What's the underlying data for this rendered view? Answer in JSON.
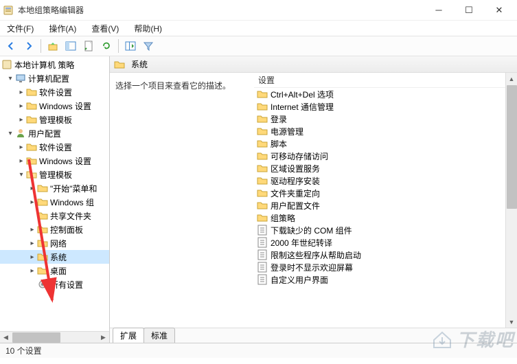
{
  "window": {
    "title": "本地组策略编辑器"
  },
  "menubar": [
    "文件(F)",
    "操作(A)",
    "查看(V)",
    "帮助(H)"
  ],
  "tree": {
    "root": "本地计算机 策略",
    "computer_config": "计算机配置",
    "cc_children": [
      "软件设置",
      "Windows 设置",
      "管理模板"
    ],
    "user_config": "用户配置",
    "uc_software": "软件设置",
    "uc_windows": "Windows 设置",
    "uc_admin": "管理模板",
    "admin_children": [
      "\"开始\"菜单和",
      "Windows 组",
      "共享文件夹",
      "控制面板",
      "网络",
      "系统",
      "桌面",
      "所有设置"
    ],
    "selected": "系统"
  },
  "right": {
    "header": "系统",
    "description": "选择一个项目来查看它的描述。",
    "column": "设置",
    "items": [
      {
        "icon": "folder",
        "label": "Ctrl+Alt+Del 选项"
      },
      {
        "icon": "folder",
        "label": "Internet 通信管理"
      },
      {
        "icon": "folder",
        "label": "登录"
      },
      {
        "icon": "folder",
        "label": "电源管理"
      },
      {
        "icon": "folder",
        "label": "脚本"
      },
      {
        "icon": "folder",
        "label": "可移动存储访问"
      },
      {
        "icon": "folder",
        "label": "区域设置服务"
      },
      {
        "icon": "folder",
        "label": "驱动程序安装"
      },
      {
        "icon": "folder",
        "label": "文件夹重定向"
      },
      {
        "icon": "folder",
        "label": "用户配置文件"
      },
      {
        "icon": "folder",
        "label": "组策略"
      },
      {
        "icon": "setting",
        "label": "下载缺少的 COM 组件"
      },
      {
        "icon": "setting",
        "label": "2000 年世纪转译"
      },
      {
        "icon": "setting",
        "label": "限制这些程序从帮助启动"
      },
      {
        "icon": "setting",
        "label": "登录时不显示欢迎屏幕"
      },
      {
        "icon": "setting",
        "label": "自定义用户界面"
      }
    ],
    "tabs": [
      "扩展",
      "标准"
    ],
    "active_tab": 0
  },
  "status": "10 个设置",
  "watermark": "下载吧"
}
